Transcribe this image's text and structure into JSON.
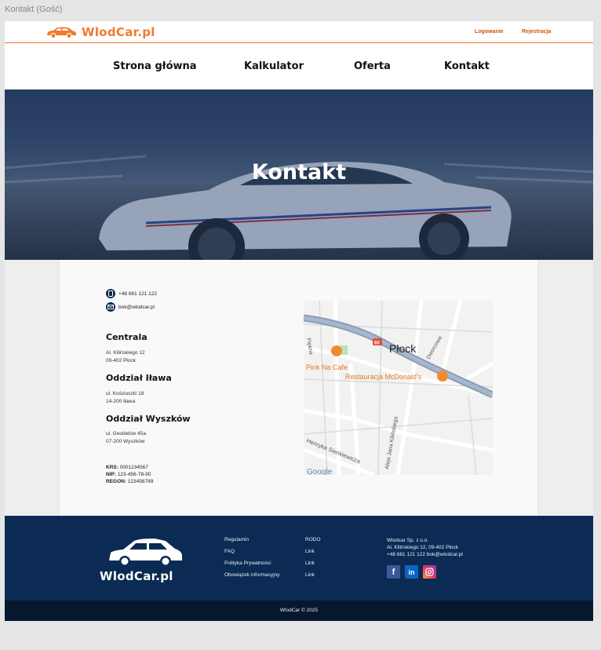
{
  "window": {
    "title": "Kontakt (Gość)"
  },
  "brand": {
    "name": "WlodCar.pl",
    "accent": "#f07a2e",
    "navy": "#0b2b55"
  },
  "auth": {
    "login": "Logowanie",
    "register": "Rejestracja"
  },
  "nav": {
    "items": [
      "Strona główna",
      "Kalkulator",
      "Oferta",
      "Kontakt"
    ]
  },
  "hero": {
    "title": "Kontakt"
  },
  "contact": {
    "phone": "+48 661 121 122",
    "email": "bok@wlodcar.pl"
  },
  "branches": [
    {
      "name": "Centrala",
      "line1": "Al. Kilińskiego 12",
      "line2": "09-402 Płock"
    },
    {
      "name": "Oddział Iława",
      "line1": "ul. Kościuszki 18",
      "line2": "14-200 Iława"
    },
    {
      "name": "Oddział Wyszków",
      "line1": "ul. Geodetów 45a",
      "line2": "07-200 Wyszków"
    }
  ],
  "registry": [
    {
      "label": "KRS:",
      "value": "0001234567"
    },
    {
      "label": "NIP:",
      "value": "123-456-78-90"
    },
    {
      "label": "REGON:",
      "value": "123456789"
    }
  ],
  "map": {
    "city": "Płock",
    "road_badge": "60",
    "labels": {
      "pink_cafe": "Pink Na Cafe",
      "mcdonalds": "Restauracja McDonald's",
      "dworcowa": "Dworcowa",
      "piekna": "Piękna",
      "kilinskiego": "Aleja Jana Kilińskiego",
      "sienkiewicza": "Henryka Sienkiewicza",
      "google": "Google"
    }
  },
  "footer": {
    "links_col1": [
      "Regulamin",
      "FAQ",
      "Polityka Prywatności",
      "Obowiązek informacyjny"
    ],
    "links_col2": [
      "RODO",
      "Link",
      "Link",
      "Link"
    ],
    "company": "Wlodcar Sp. z o.o.",
    "address": "Al. Kilińskiego 12, 09-402 Płock",
    "contact_line": "+48 661 121 122 bok@wlodcar.pl",
    "social": [
      "facebook-icon",
      "linkedin-icon",
      "instagram-icon"
    ],
    "copyright": "WlodCar © 2025"
  }
}
